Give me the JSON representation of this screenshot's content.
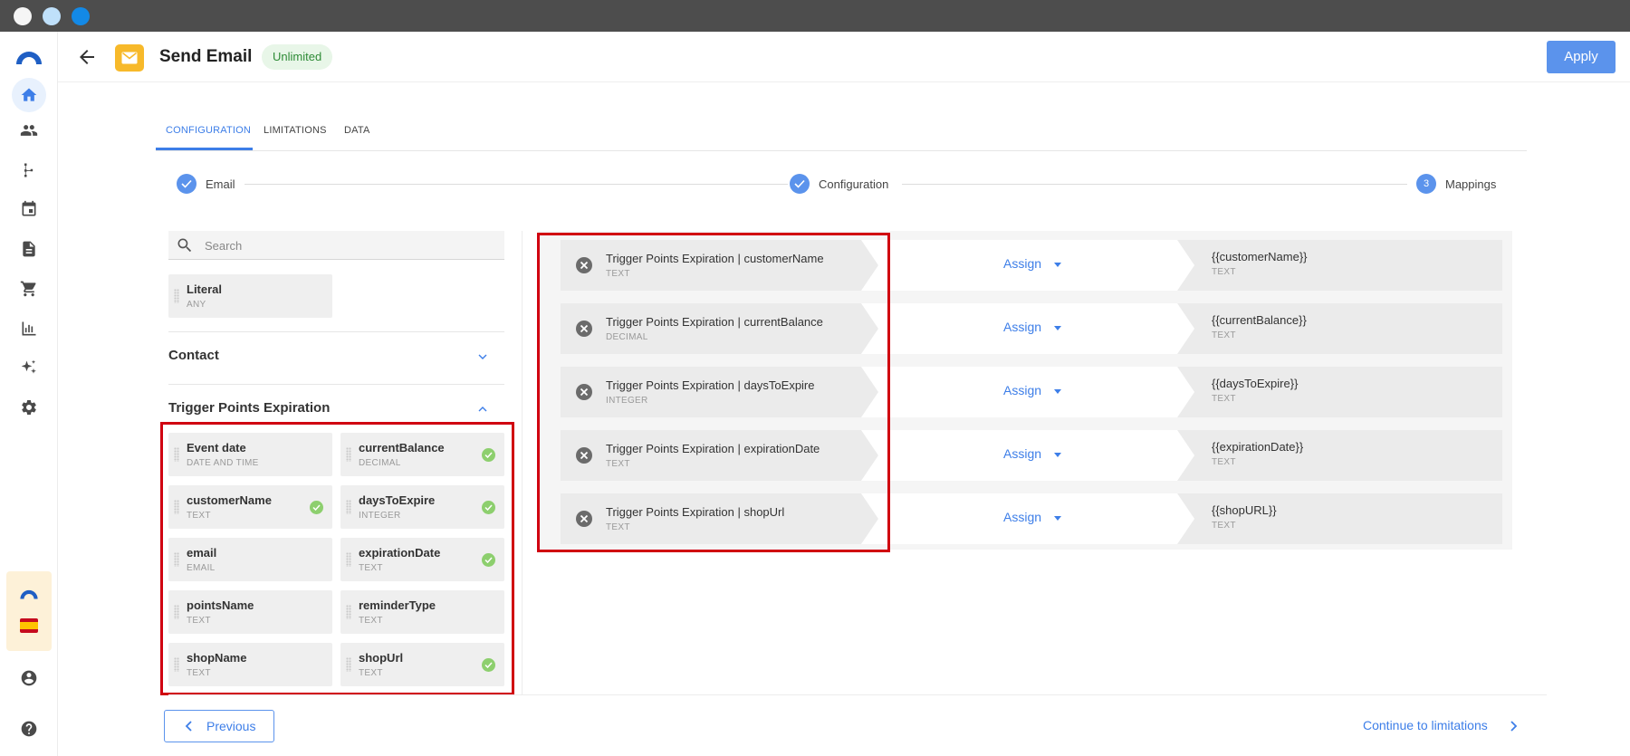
{
  "window": {
    "controls": [
      "close",
      "minimize",
      "maximize"
    ]
  },
  "sidebar": {
    "logo": "brand-arc-logo",
    "items": [
      {
        "icon": "home-icon",
        "active": true
      },
      {
        "icon": "contacts-icon"
      },
      {
        "icon": "workflow-icon"
      },
      {
        "icon": "calendar-icon"
      },
      {
        "icon": "document-icon"
      },
      {
        "icon": "cart-icon"
      },
      {
        "icon": "analytics-icon"
      },
      {
        "icon": "sparkles-icon"
      },
      {
        "icon": "settings-icon"
      }
    ],
    "bottom": [
      "account-icon",
      "help-icon"
    ]
  },
  "header": {
    "title": "Send Email",
    "badge": "Unlimited",
    "apply_label": "Apply",
    "colors": {
      "accent": "#5b93ec",
      "app_icon": "#f7b92a",
      "badge_bg": "#e8f6e8",
      "badge_text": "#2e8b36"
    }
  },
  "tabs": [
    {
      "label": "CONFIGURATION",
      "active": true
    },
    {
      "label": "LIMITATIONS"
    },
    {
      "label": "DATA"
    }
  ],
  "stepper": [
    {
      "label": "Email",
      "state": "done"
    },
    {
      "label": "Configuration",
      "state": "done"
    },
    {
      "label": "Mappings",
      "state": "current",
      "number": "3"
    }
  ],
  "search": {
    "placeholder": "Search",
    "value": ""
  },
  "literal": {
    "name": "Literal",
    "type": "ANY"
  },
  "groups": {
    "contact": {
      "title": "Contact",
      "expanded": false
    },
    "trigger": {
      "title": "Trigger Points Expiration",
      "expanded": true
    }
  },
  "fields": [
    {
      "name": "Event date",
      "type": "DATE AND TIME",
      "mapped": false
    },
    {
      "name": "currentBalance",
      "type": "DECIMAL",
      "mapped": true
    },
    {
      "name": "customerName",
      "type": "TEXT",
      "mapped": true
    },
    {
      "name": "daysToExpire",
      "type": "INTEGER",
      "mapped": true
    },
    {
      "name": "email",
      "type": "EMAIL",
      "mapped": false
    },
    {
      "name": "expirationDate",
      "type": "TEXT",
      "mapped": true
    },
    {
      "name": "pointsName",
      "type": "TEXT",
      "mapped": false
    },
    {
      "name": "reminderType",
      "type": "TEXT",
      "mapped": false
    },
    {
      "name": "shopName",
      "type": "TEXT",
      "mapped": false
    },
    {
      "name": "shopUrl",
      "type": "TEXT",
      "mapped": true
    }
  ],
  "mappings": [
    {
      "source": "Trigger Points Expiration | customerName",
      "source_type": "TEXT",
      "action": "Assign",
      "target": "{{customerName}}",
      "target_type": "TEXT"
    },
    {
      "source": "Trigger Points Expiration | currentBalance",
      "source_type": "DECIMAL",
      "action": "Assign",
      "target": "{{currentBalance}}",
      "target_type": "TEXT"
    },
    {
      "source": "Trigger Points Expiration | daysToExpire",
      "source_type": "INTEGER",
      "action": "Assign",
      "target": "{{daysToExpire}}",
      "target_type": "TEXT"
    },
    {
      "source": "Trigger Points Expiration | expirationDate",
      "source_type": "TEXT",
      "action": "Assign",
      "target": "{{expirationDate}}",
      "target_type": "TEXT"
    },
    {
      "source": "Trigger Points Expiration | shopUrl",
      "source_type": "TEXT",
      "action": "Assign",
      "target": "{{shopURL}}",
      "target_type": "TEXT"
    }
  ],
  "footer": {
    "previous_label": "Previous",
    "next_label": "Continue to limitations"
  },
  "highlight": {
    "color": "#d00010"
  }
}
